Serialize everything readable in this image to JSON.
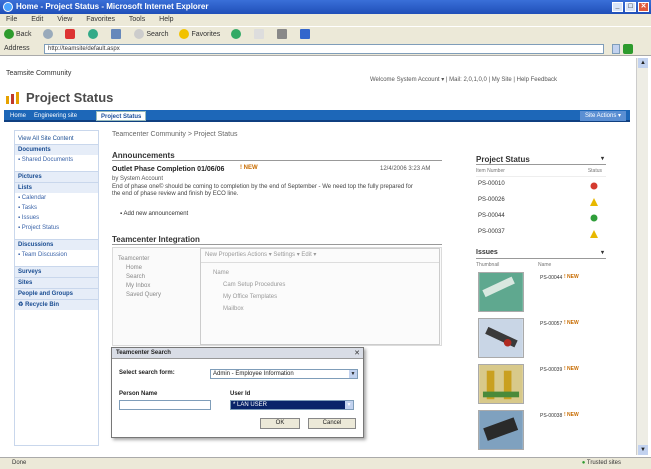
{
  "window": {
    "title": "Home - Project Status - Microsoft Internet Explorer"
  },
  "menu": [
    "File",
    "Edit",
    "View",
    "Favorites",
    "Tools",
    "Help"
  ],
  "toolbar": {
    "back": "Back",
    "search": "Search",
    "favorites": "Favorites"
  },
  "address": {
    "label": "Address",
    "value": "http://teamsite/default.aspx"
  },
  "site": {
    "name": "Teamsite Community",
    "welcome": "Welcome System Account ▾ | Mail: 2,0,1,0,0 | My Site | Help Feedback",
    "title": "Project Status"
  },
  "tabs": [
    {
      "label": "Home"
    },
    {
      "label": "Engineering site"
    },
    {
      "label": "Project Status"
    }
  ],
  "site_actions": "Site Actions ▾",
  "nav": {
    "view_all": "View All Site Content",
    "documents": "Documents",
    "shared_documents": "Shared Documents",
    "pictures": "Pictures",
    "lists": "Lists",
    "calendar": "Calendar",
    "tasks": "Tasks",
    "issues": "Issues",
    "project_status": "Project Status",
    "discussions": "Discussions",
    "team_discussion": "Team Discussion",
    "surveys": "Surveys",
    "sites": "Sites",
    "people": "People and Groups",
    "recycle_bin": "Recycle Bin"
  },
  "breadcrumb": "Teamcenter Community > Project Status",
  "announcements": {
    "header": "Announcements",
    "title": "Outlet Phase Completion 01/06/06",
    "new": "! NEW",
    "date": "12/4/2006 3:23 AM",
    "by": "by System Account",
    "body": "End of phase one© should be coming to completion by the end of September - We need top the fully prepared for the end of phase review and finish by ECO line.",
    "add": "Add new announcement"
  },
  "integration": {
    "header": "Teamcenter Integration",
    "tree": [
      "Teamcenter",
      "Home",
      "Search",
      "My Inbox",
      "Saved Query"
    ],
    "toolbar": "New   Properties   Actions ▾   Settings ▾   Edit ▾",
    "rows": [
      "Name",
      "Cam Setup Procedures",
      "My Office Templates",
      "Mailbox"
    ]
  },
  "dialog": {
    "title": "Teamcenter Search",
    "search_form_label": "Select search form:",
    "search_form_value": "Admin - Employee Information",
    "person_label": "Person Name",
    "user_label": "User Id",
    "user_value": "* LAN USER",
    "ok": "OK",
    "cancel": "Cancel"
  },
  "project_status": {
    "header": "Project Status",
    "col_item": "Item Number",
    "col_status": "Status",
    "rows": [
      {
        "id": "PS-00010",
        "status": "red"
      },
      {
        "id": "PS-00026",
        "status": "yellow"
      },
      {
        "id": "PS-00044",
        "status": "green"
      },
      {
        "id": "PS-00037",
        "status": "yellow"
      }
    ]
  },
  "issues": {
    "header": "Issues",
    "col_image": "Thumbnail",
    "col_name": "Name",
    "rows": [
      {
        "id": "PS-00044",
        "new": "! NEW"
      },
      {
        "id": "PS-00057",
        "new": "! NEW"
      },
      {
        "id": "PS-00039",
        "new": "! NEW"
      },
      {
        "id": "PS-00038",
        "new": "! NEW"
      }
    ]
  },
  "statusbar": {
    "left": "Done",
    "zone": "Trusted sites"
  }
}
